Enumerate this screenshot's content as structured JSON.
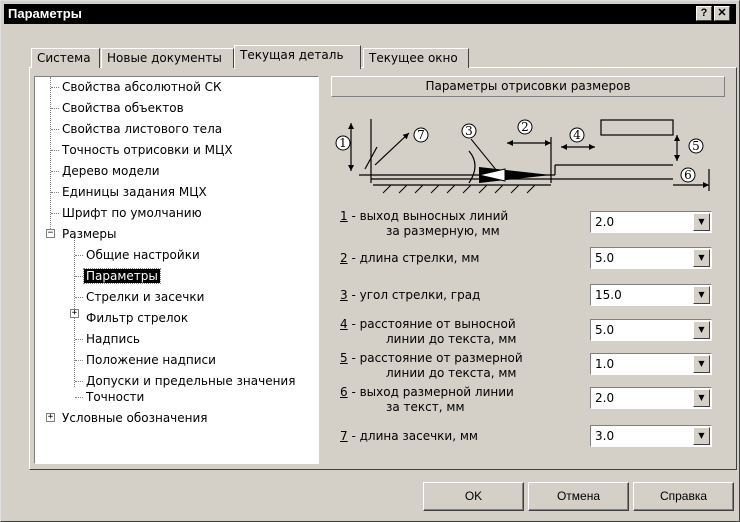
{
  "window": {
    "title": "Параметры",
    "help_glyph": "?",
    "close_glyph": "✕"
  },
  "tabs": [
    {
      "label": "Система"
    },
    {
      "label": "Новые документы"
    },
    {
      "label": "Текущая деталь"
    },
    {
      "label": "Текущее окно"
    }
  ],
  "tree": {
    "items": [
      "Свойства абсолютной СК",
      "Свойства объектов",
      "Свойства листового тела",
      "Точность отрисовки и МЦХ",
      "Дерево модели",
      "Единицы задания МЦХ",
      "Шрифт по умолчанию",
      "Размеры",
      "Общие настройки",
      "Параметры",
      "Стрелки и засечки",
      "Фильтр стрелок",
      "Надпись",
      "Положение надписи",
      "Допуски и предельные значения",
      "Точности",
      "Условные обозначения"
    ],
    "collapse_glyph": "−",
    "expand_glyph": "+"
  },
  "section_title": "Параметры отрисовки размеров",
  "diagram": {
    "markers": [
      "1",
      "2",
      "3",
      "4",
      "5",
      "6",
      "7"
    ]
  },
  "params": [
    {
      "num": "1",
      "line1": " - выход выносных линий",
      "line2": "за размерную, мм",
      "value": "2.0"
    },
    {
      "num": "2",
      "line1": " - длина стрелки, мм",
      "line2": "",
      "value": "5.0"
    },
    {
      "num": "3",
      "line1": " - угол стрелки, град",
      "line2": "",
      "value": "15.0"
    },
    {
      "num": "4",
      "line1": " - расстояние от выносной",
      "line2": "линии до текста, мм",
      "value": "5.0"
    },
    {
      "num": "5",
      "line1": " - расстояние от размерной",
      "line2": "линии до текста, мм",
      "value": "1.0"
    },
    {
      "num": "6",
      "line1": " - выход размерной линии",
      "line2": "за текст, мм",
      "value": "2.0"
    },
    {
      "num": "7",
      "line1": " - длина засечки, мм",
      "line2": "",
      "value": "3.0"
    }
  ],
  "combo_arrow": "▼",
  "buttons": {
    "ok": "OK",
    "cancel": "Отмена",
    "help": "Справка"
  }
}
